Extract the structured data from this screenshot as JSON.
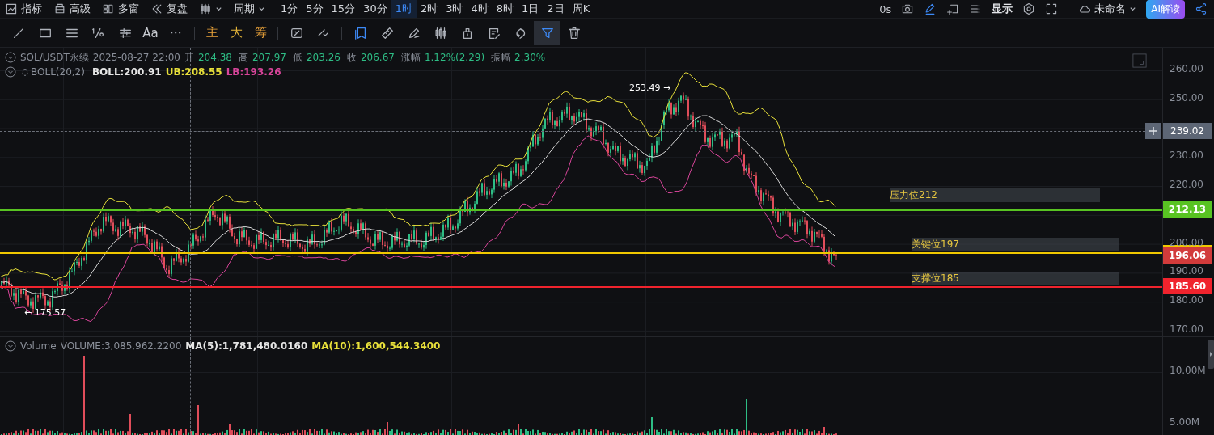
{
  "top_bar": {
    "menu": [
      {
        "label": "指标"
      },
      {
        "label": "高级"
      },
      {
        "label": "多窗"
      },
      {
        "label": "复盘"
      }
    ],
    "period_label": "周期",
    "intervals": [
      {
        "label": "1分",
        "selected": false
      },
      {
        "label": "5分",
        "selected": false
      },
      {
        "label": "15分",
        "selected": false
      },
      {
        "label": "30分",
        "selected": false
      },
      {
        "label": "1时",
        "selected": true
      },
      {
        "label": "2时",
        "selected": false
      },
      {
        "label": "3时",
        "selected": false
      },
      {
        "label": "4时",
        "selected": false
      },
      {
        "label": "8时",
        "selected": false
      },
      {
        "label": "1日",
        "selected": false
      },
      {
        "label": "2日",
        "selected": false
      },
      {
        "label": "周K",
        "selected": false
      }
    ],
    "timer": "0s",
    "display_label": "显示",
    "layout_name": "未命名",
    "ai_button": "AI解读"
  },
  "tool_groups": [
    {
      "tools": [
        {
          "kind": "icon",
          "selected": false,
          "active": false
        },
        {
          "kind": "icon",
          "selected": false,
          "active": false
        },
        {
          "kind": "icon",
          "selected": false,
          "active": false
        },
        {
          "kind": "icon",
          "selected": false,
          "active": false
        },
        {
          "kind": "icon",
          "selected": false,
          "active": false
        },
        {
          "kind": "text",
          "label": "Aa",
          "color": "#c8cbd1"
        },
        {
          "kind": "icon",
          "selected": false,
          "active": false
        }
      ]
    },
    {
      "tools": [
        {
          "kind": "text",
          "label": "主",
          "color": "#e8a23a"
        },
        {
          "kind": "text",
          "label": "大",
          "color": "#e8b73a"
        },
        {
          "kind": "text",
          "label": "筹",
          "color": "#e8a23a"
        }
      ]
    },
    {
      "tools": [
        {
          "kind": "icon",
          "selected": false,
          "active": false
        },
        {
          "kind": "icon",
          "selected": false,
          "active": false
        }
      ]
    },
    {
      "tools": [
        {
          "kind": "icon",
          "selected": false,
          "active": true
        },
        {
          "kind": "icon",
          "selected": false,
          "active": false
        },
        {
          "kind": "icon",
          "selected": false,
          "active": false
        },
        {
          "kind": "icon",
          "selected": false,
          "active": false
        },
        {
          "kind": "icon",
          "selected": false,
          "active": false
        },
        {
          "kind": "icon",
          "selected": false,
          "active": false
        },
        {
          "kind": "icon",
          "selected": false,
          "active": false
        },
        {
          "kind": "icon",
          "selected": true,
          "active": true
        },
        {
          "kind": "icon",
          "selected": false,
          "active": false
        }
      ]
    }
  ],
  "chart": {
    "symbol": "SOL/USDT永续",
    "datetime": "2025-08-27 22:00",
    "ohlc": [
      {
        "label": "开",
        "value": "204.38"
      },
      {
        "label": "高",
        "value": "207.97"
      },
      {
        "label": "低",
        "value": "203.26"
      },
      {
        "label": "收",
        "value": "206.67"
      },
      {
        "label": "涨幅",
        "value": "1.12%(2.29)"
      },
      {
        "label": "振幅",
        "value": "2.30%"
      }
    ],
    "indicator": "BOLL(20,2)",
    "indicator_values": [
      {
        "text": "BOLL:200.91",
        "color": "#e6e6e6"
      },
      {
        "text": "UB:208.55",
        "color": "#e8e03a"
      },
      {
        "text": "LB:193.26",
        "color": "#d8459a"
      }
    ],
    "high_marker": "253.49 →",
    "low_marker": "← 175.57",
    "axis_ticks": [
      "260.00",
      "250.00",
      "230.00",
      "220.00",
      "200.00",
      "190.00",
      "180.00",
      "170.00"
    ],
    "crosshair_price": "239.02",
    "levels": [
      {
        "text": "压力位212",
        "color": "#58c322",
        "tag": "212.13"
      },
      {
        "text": "关键位197",
        "color": "#f0c800"
      },
      {
        "text": "支撑位185",
        "color": "#f0232d",
        "tag": "185.60"
      }
    ],
    "current_price": "196.06"
  },
  "volume": {
    "name": "Volume",
    "values": [
      {
        "text": "VOLUME:3,085,962.2200",
        "color": "#8a8f99"
      },
      {
        "text": "MA(5):1,781,480.0160",
        "color": "#e6e6e6"
      },
      {
        "text": "MA(10):1,600,544.3400",
        "color": "#e8e03a"
      }
    ],
    "axis_ticks": [
      "10.00M",
      "5.00M"
    ]
  }
}
